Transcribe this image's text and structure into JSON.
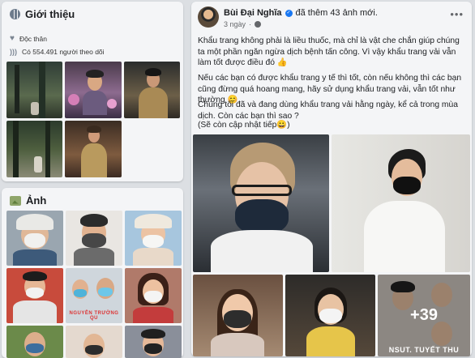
{
  "intro": {
    "title": "Giới thiệu",
    "relationship": "Độc thân",
    "followers": "Có 554.491 người theo dõi"
  },
  "photos": {
    "title": "Ảnh",
    "watermark": "NGUYỄN TRƯỜNG QU"
  },
  "post": {
    "author": "Bùi Đại Nghĩa",
    "action": "đã thêm 43 ảnh mới.",
    "time": "3 ngày",
    "paragraphs": [
      "Khẩu trang không phải là liều thuốc, mà chỉ là vật che chắn giúp chúng ta một phần ngăn ngừa dịch bệnh tấn công. Vì vậy khẩu trang vải vẫn làm tốt được điều đó 👍",
      "Nếu các bạn có được khẩu trang y tế thì tốt, còn nếu không thì các bạn cũng đừng quá hoang mang, hãy sử dụng khẩu trang vải, vẫn tốt như thường 😊",
      "Chúng tôi đã và đang dùng khẩu trang vải hằng ngày, kể cả trong mùa dịch. Còn các bạn thì sao ?",
      "(Sẽ còn cập nhật tiếp😀)"
    ],
    "more_photos": "+39",
    "last_caption": "NSUT. TUYẾT THU"
  },
  "colors": {
    "background": "#dcdfe3",
    "card": "#f4f5f7",
    "verified": "#1877f2"
  },
  "icons": [
    "globe-icon",
    "heart-icon",
    "rss-icon",
    "photo-icon",
    "verified-icon",
    "more-icon"
  ]
}
